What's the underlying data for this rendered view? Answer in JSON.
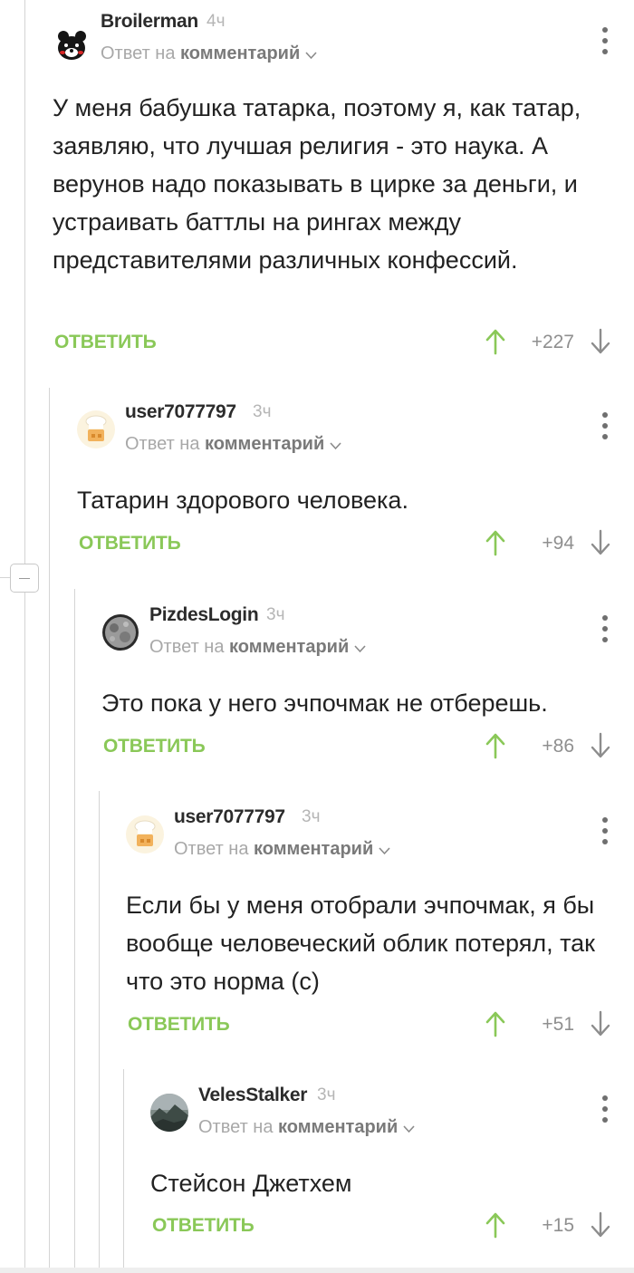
{
  "comments": [
    {
      "author": "Broilerman",
      "time": "4ч",
      "reply_prefix": "Ответ на",
      "reply_target": "комментарий",
      "avatar": "bear-avatar-icon",
      "text": "У меня бабушка татарка, поэтому я, как татар, заявляю, что лучшая религия - это наука. А верунов надо показывать в цирке за деньги, и устраивать баттлы на рингах между представителями различных конфессий.",
      "reply_label": "ОТВЕТИТЬ",
      "score": "+227"
    },
    {
      "author": "user7077797",
      "time": "3ч",
      "reply_prefix": "Ответ на",
      "reply_target": "комментарий",
      "avatar": "chef-avatar-icon",
      "text": "Татарин здорового человека.",
      "reply_label": "ОТВЕТИТЬ",
      "score": "+94"
    },
    {
      "author": "PizdesLogin",
      "time": "3ч",
      "reply_prefix": "Ответ на",
      "reply_target": "комментарий",
      "avatar": "moon-avatar-icon",
      "text": "Это пока у него эчпочмак не отберешь.",
      "reply_label": "ОТВЕТИТЬ",
      "score": "+86"
    },
    {
      "author": "user7077797",
      "time": "3ч",
      "reply_prefix": "Ответ на",
      "reply_target": "комментарий",
      "avatar": "chef-avatar-icon",
      "text": "Если бы у меня отобрали эчпочмак, я бы вообще человеческий облик потерял, так что это норма (с)",
      "reply_label": "ОТВЕТИТЬ",
      "score": "+51"
    },
    {
      "author": "VelesStalker",
      "time": "3ч",
      "reply_prefix": "Ответ на",
      "reply_target": "комментарий",
      "avatar": "landscape-avatar-icon",
      "text": "Стейсон Джетхем",
      "reply_label": "ОТВЕТИТЬ",
      "score": "+15"
    }
  ],
  "colors": {
    "reply_green": "#8ac858",
    "upvote_green": "#8ac858",
    "thread_line": "#d4d4d4",
    "muted_text": "#a8a8a8"
  }
}
